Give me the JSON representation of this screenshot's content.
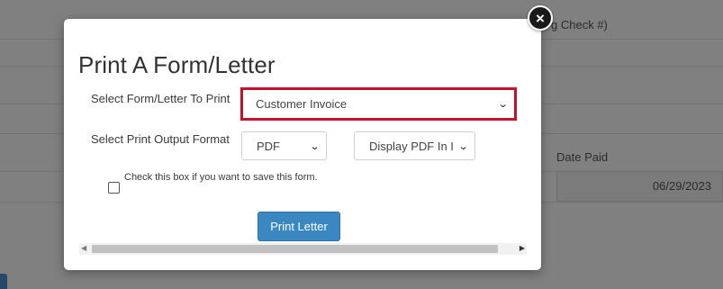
{
  "background": {
    "partial_label_top": "g Check #)",
    "date_paid_label": "Date Paid",
    "date_paid_value": "06/29/2023"
  },
  "modal": {
    "close_icon": "×",
    "title": "Print A Form/Letter",
    "form_letter_label": "Select Form/Letter To Print",
    "form_letter_value": "Customer Invoice",
    "output_format_label": "Select Print Output Format",
    "format_value": "PDF",
    "display_value": "Display PDF In I",
    "save_checkbox_label": "Check this box if you want to save this form.",
    "save_checked": false,
    "print_button_label": "Print Letter"
  },
  "colors": {
    "highlight_border": "#c4122e",
    "primary_button": "#3a87c2"
  },
  "icons": {
    "close": "close-icon",
    "dropdown": "chevron-down-icon"
  }
}
